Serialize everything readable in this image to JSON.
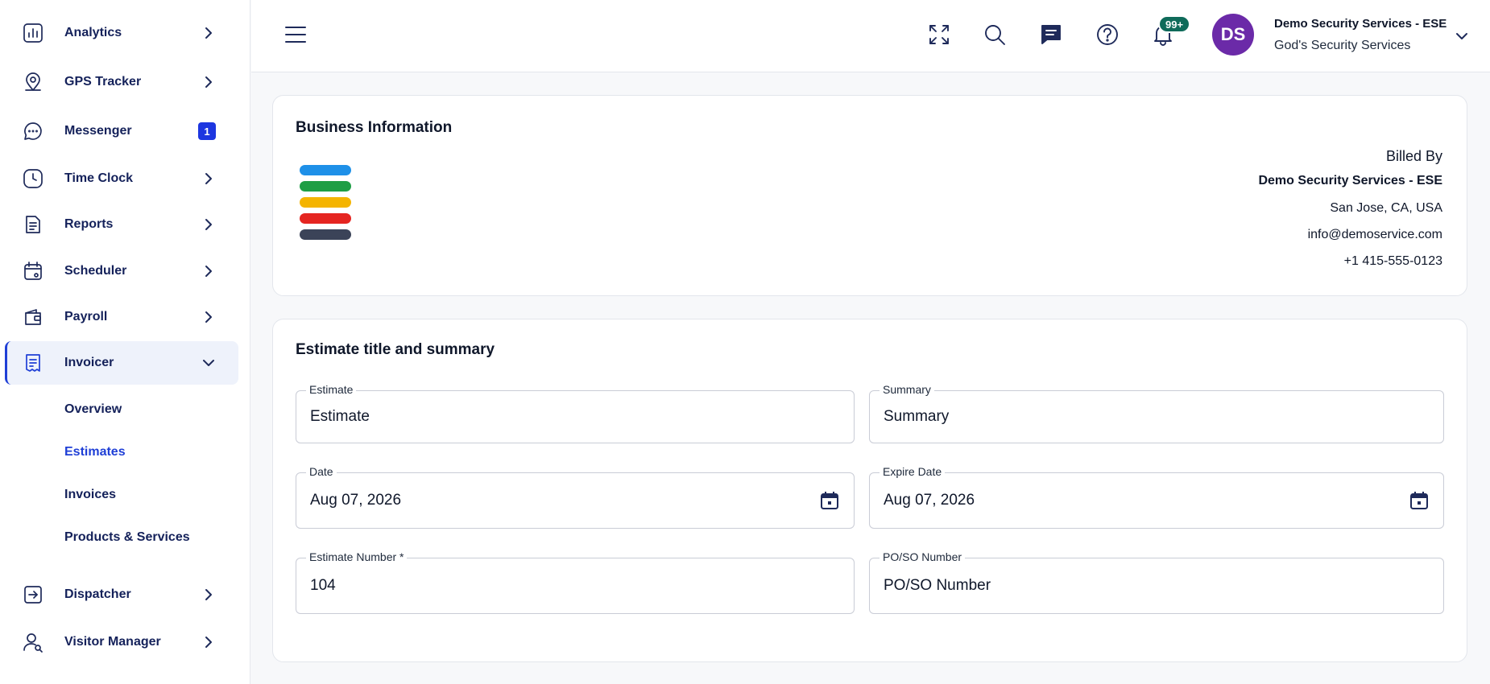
{
  "sidebar": {
    "items": [
      {
        "label": "Analytics",
        "icon": "bar-chart-icon"
      },
      {
        "label": "GPS Tracker",
        "icon": "map-pin-icon"
      },
      {
        "label": "Messenger",
        "icon": "chat-bubble-icon",
        "badge": "1"
      },
      {
        "label": "Time Clock",
        "icon": "clock-icon"
      },
      {
        "label": "Reports",
        "icon": "report-icon"
      },
      {
        "label": "Scheduler",
        "icon": "calendar-icon"
      },
      {
        "label": "Payroll",
        "icon": "wallet-icon"
      },
      {
        "label": "Invoicer",
        "icon": "invoice-icon",
        "expanded": true
      },
      {
        "label": "Dispatcher",
        "icon": "dispatch-arrow-icon"
      },
      {
        "label": "Visitor Manager",
        "icon": "visitor-icon"
      }
    ],
    "invoicer_sub": [
      "Overview",
      "Estimates",
      "Invoices",
      "Products & Services"
    ],
    "active_sub": "Estimates"
  },
  "header": {
    "notif_badge": "99+",
    "avatar_initials": "DS",
    "avatar_color": "#6b2aa8",
    "user_name": "Demo Security Services - ESE",
    "user_company": "God's Security Services"
  },
  "business": {
    "title": "Business Information",
    "logo_colors": [
      "#1e90e8",
      "#1f9e45",
      "#f4b400",
      "#e52521",
      "#3b4358"
    ],
    "billed_by_label": "Billed By",
    "billed_by_name": "Demo Security Services - ESE",
    "location": "San Jose, CA, USA",
    "email": "info@demoservice.com",
    "phone": "+1 415-555-0123"
  },
  "estimate": {
    "title": "Estimate title and summary",
    "fields": {
      "estimate": {
        "label": "Estimate",
        "value": "Estimate"
      },
      "summary": {
        "label": "Summary",
        "value": "Summary"
      },
      "date": {
        "label": "Date",
        "value": "Aug 07, 2026"
      },
      "expire_date": {
        "label": "Expire Date",
        "value": "Aug 07, 2026"
      },
      "estimate_number": {
        "label": "Estimate Number *",
        "value": "104"
      },
      "po_so_number": {
        "label": "PO/SO Number",
        "value": "PO/SO Number"
      }
    }
  },
  "colors": {
    "accent": "#1f3fd6",
    "nav_text": "#14215a",
    "badge_blue": "#1d36e0",
    "notif_green": "#0f6b5a"
  }
}
